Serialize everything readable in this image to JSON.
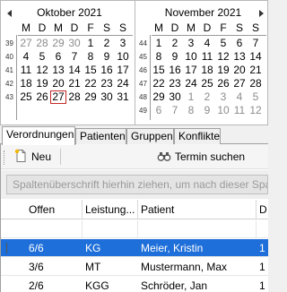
{
  "calendar": {
    "left": {
      "title": "Oktober 2021",
      "dow": [
        "M",
        "D",
        "M",
        "D",
        "F",
        "S",
        "S"
      ],
      "weeks": [
        "39",
        "40",
        "41",
        "42",
        "43"
      ],
      "rows": [
        [
          {
            "d": "27",
            "o": true
          },
          {
            "d": "28",
            "o": true
          },
          {
            "d": "29",
            "o": true
          },
          {
            "d": "30",
            "o": true
          },
          {
            "d": "1"
          },
          {
            "d": "2"
          },
          {
            "d": "3"
          }
        ],
        [
          {
            "d": "4"
          },
          {
            "d": "5"
          },
          {
            "d": "6"
          },
          {
            "d": "7"
          },
          {
            "d": "8"
          },
          {
            "d": "9"
          },
          {
            "d": "10"
          }
        ],
        [
          {
            "d": "11"
          },
          {
            "d": "12"
          },
          {
            "d": "13"
          },
          {
            "d": "14"
          },
          {
            "d": "15"
          },
          {
            "d": "16"
          },
          {
            "d": "17"
          }
        ],
        [
          {
            "d": "18"
          },
          {
            "d": "19"
          },
          {
            "d": "20"
          },
          {
            "d": "21"
          },
          {
            "d": "22"
          },
          {
            "d": "23"
          },
          {
            "d": "24"
          }
        ],
        [
          {
            "d": "25"
          },
          {
            "d": "26"
          },
          {
            "d": "27",
            "today": true
          },
          {
            "d": "28"
          },
          {
            "d": "29"
          },
          {
            "d": "30"
          },
          {
            "d": "31"
          }
        ]
      ]
    },
    "right": {
      "title": "November 2021",
      "dow": [
        "M",
        "D",
        "M",
        "D",
        "F",
        "S",
        "S"
      ],
      "weeks": [
        "44",
        "45",
        "46",
        "47",
        "48",
        "49"
      ],
      "rows": [
        [
          {
            "d": "1"
          },
          {
            "d": "2"
          },
          {
            "d": "3"
          },
          {
            "d": "4"
          },
          {
            "d": "5"
          },
          {
            "d": "6"
          },
          {
            "d": "7"
          }
        ],
        [
          {
            "d": "8"
          },
          {
            "d": "9"
          },
          {
            "d": "10"
          },
          {
            "d": "11"
          },
          {
            "d": "12"
          },
          {
            "d": "13"
          },
          {
            "d": "14"
          }
        ],
        [
          {
            "d": "15"
          },
          {
            "d": "16"
          },
          {
            "d": "17"
          },
          {
            "d": "18"
          },
          {
            "d": "19"
          },
          {
            "d": "20"
          },
          {
            "d": "21"
          }
        ],
        [
          {
            "d": "22"
          },
          {
            "d": "23"
          },
          {
            "d": "24"
          },
          {
            "d": "25"
          },
          {
            "d": "26"
          },
          {
            "d": "27"
          },
          {
            "d": "28"
          }
        ],
        [
          {
            "d": "29"
          },
          {
            "d": "30"
          },
          {
            "d": "1",
            "o": true
          },
          {
            "d": "2",
            "o": true
          },
          {
            "d": "3",
            "o": true
          },
          {
            "d": "4",
            "o": true
          },
          {
            "d": "5",
            "o": true
          }
        ],
        [
          {
            "d": "6",
            "o": true
          },
          {
            "d": "7",
            "o": true
          },
          {
            "d": "8",
            "o": true
          },
          {
            "d": "9",
            "o": true
          },
          {
            "d": "10",
            "o": true
          },
          {
            "d": "11",
            "o": true
          },
          {
            "d": "12",
            "o": true
          }
        ]
      ]
    }
  },
  "tabs": [
    "Verordnungen",
    "Patienten",
    "Gruppen",
    "Konflikte"
  ],
  "toolbar": {
    "new_label": "Neu",
    "search_label": "Termin suchen"
  },
  "group_hint": "Spaltenüberschrift hierhin ziehen, um nach dieser Spalte zu gruppieren",
  "grid": {
    "columns": [
      "Offen",
      "Leistung...",
      "Patient",
      "D"
    ],
    "rows": [
      {
        "offen": "6/6",
        "leistung": "KG",
        "patient": "Meier, Kristin",
        "d": "1",
        "selected": true
      },
      {
        "offen": "3/6",
        "leistung": "MT",
        "patient": "Mustermann, Max",
        "d": "1",
        "selected": false
      },
      {
        "offen": "2/6",
        "leistung": "KGG",
        "patient": "Schröder, Jan",
        "d": "1",
        "selected": false
      }
    ]
  },
  "colors": {
    "selection": "#1e6fd9",
    "today_border": "#c62828"
  }
}
